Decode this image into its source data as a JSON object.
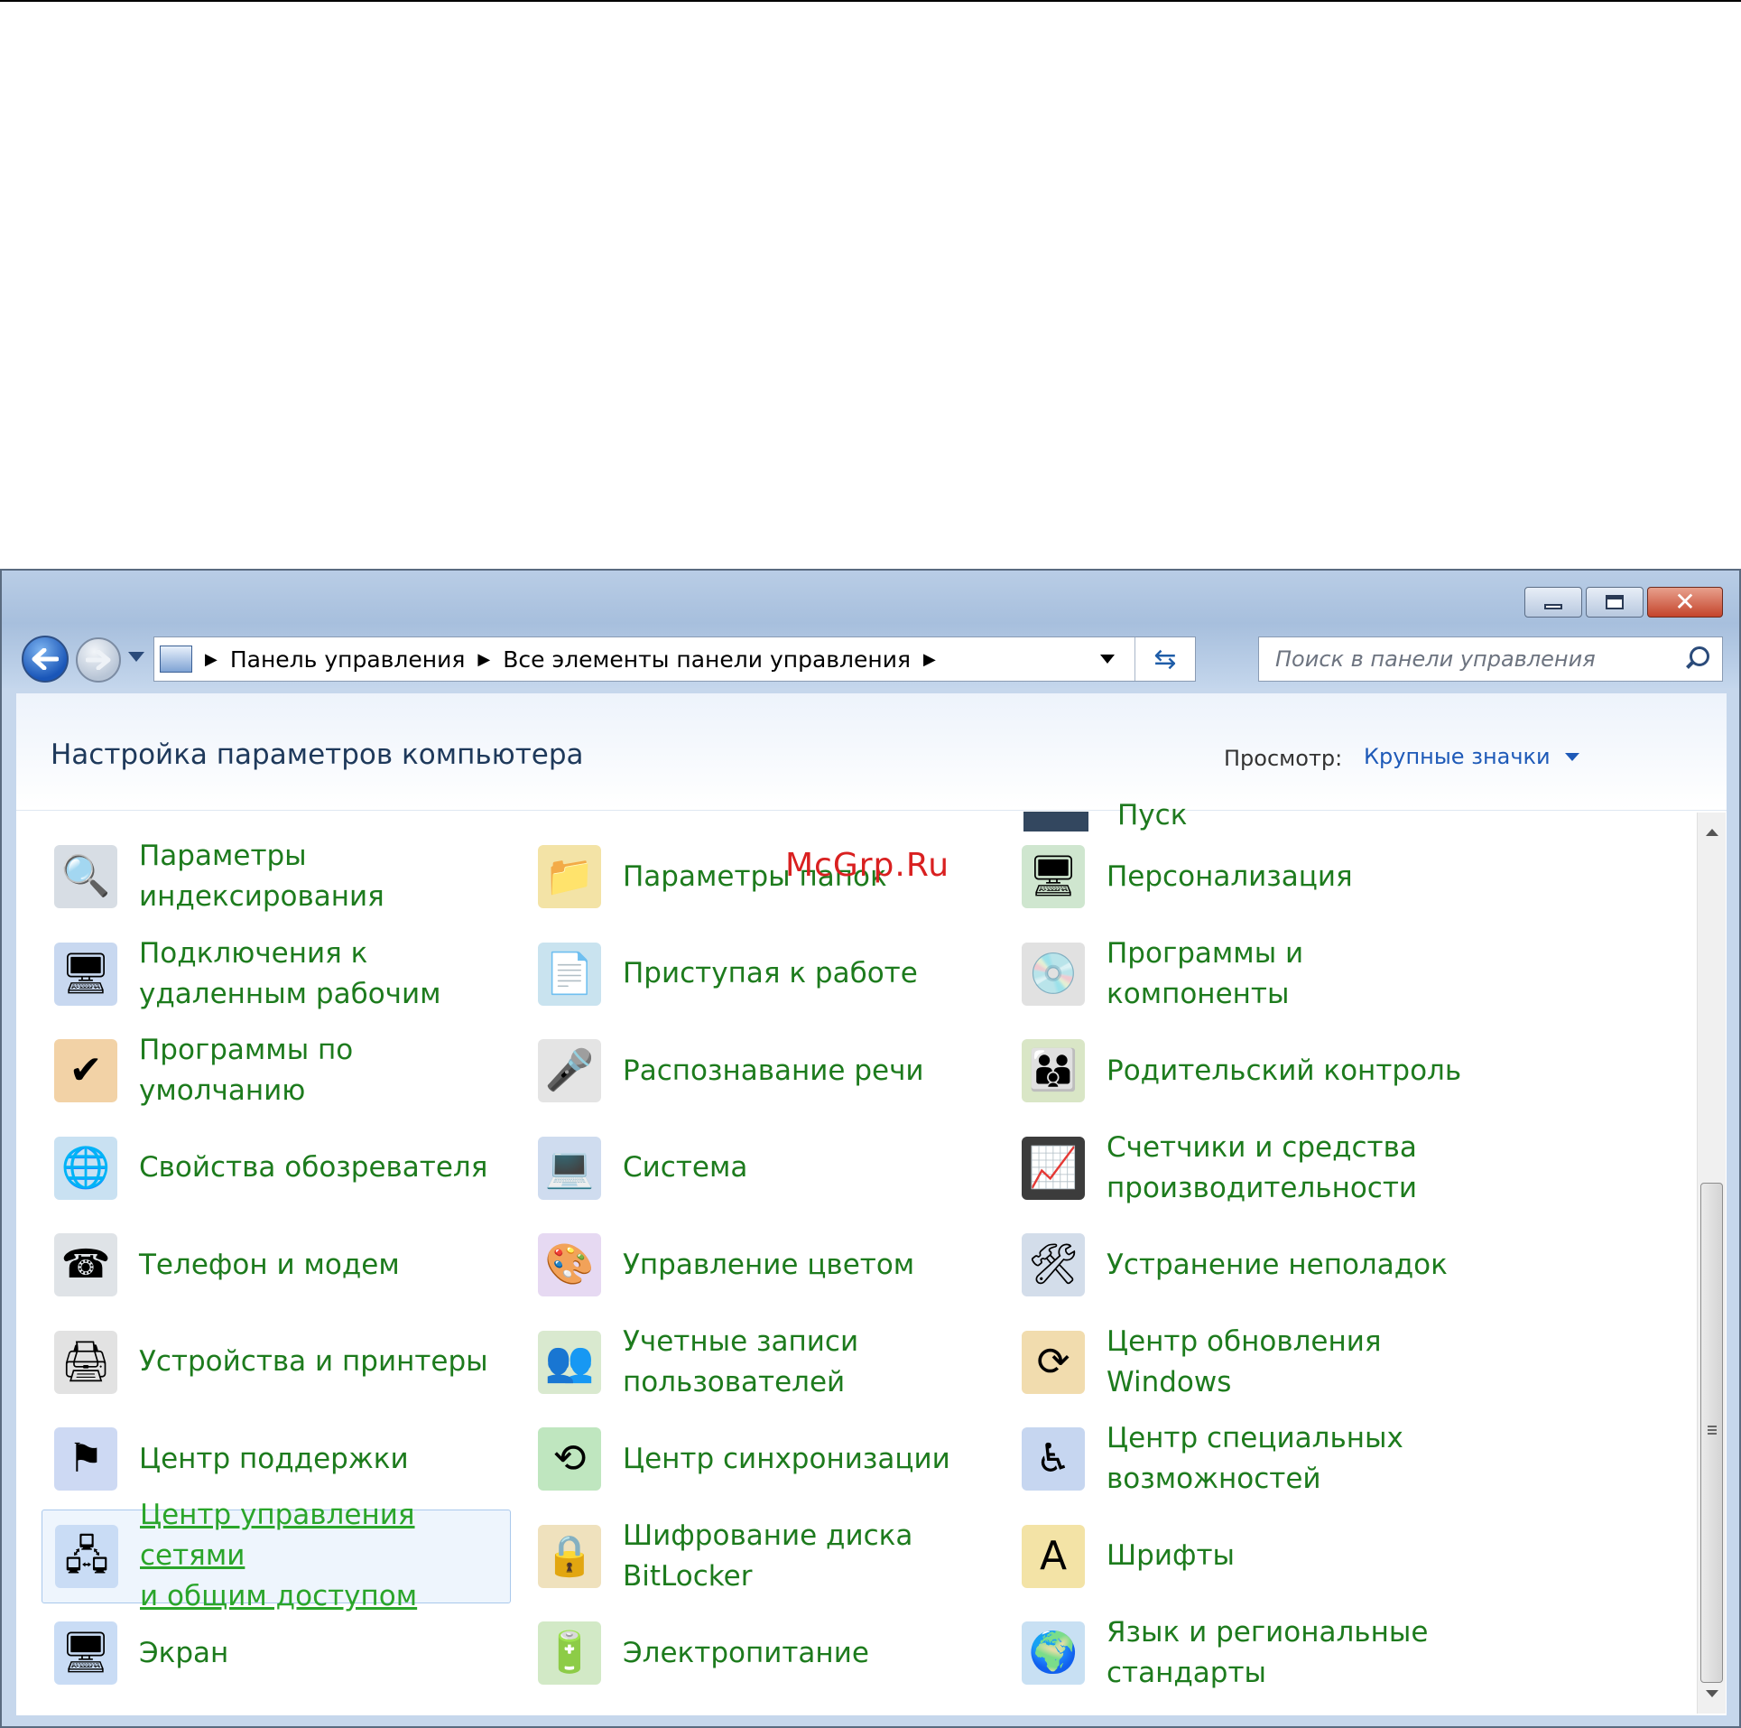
{
  "watermark": "McGrp.Ru",
  "address": {
    "crumbs": [
      "Панель управления",
      "Все элементы панели управления"
    ]
  },
  "search": {
    "placeholder": "Поиск в панели управления"
  },
  "header": {
    "title": "Настройка параметров компьютера",
    "view_label": "Просмотр:",
    "view_value": "Крупные значки"
  },
  "partial_top": {
    "col3_label": "Пуск"
  },
  "items": [
    {
      "label": "Параметры\nиндексирования",
      "icon": "magnifier-drive-icon",
      "glyph": "🔍",
      "color": "#d7dde4"
    },
    {
      "label": "Параметры папок",
      "icon": "folder-options-icon",
      "glyph": "📁",
      "color": "#f3e3a6"
    },
    {
      "label": "Персонализация",
      "icon": "monitor-personalize-icon",
      "glyph": "🖥",
      "color": "#cfe6cf"
    },
    {
      "label": "Подключения к\nудаленным рабочим",
      "icon": "remote-desktop-icon",
      "glyph": "🖥",
      "color": "#c8d8f0"
    },
    {
      "label": "Приступая к работе",
      "icon": "getting-started-icon",
      "glyph": "📄",
      "color": "#c9e3ef"
    },
    {
      "label": "Программы и\nкомпоненты",
      "icon": "programs-features-icon",
      "glyph": "💿",
      "color": "#e1e1e1"
    },
    {
      "label": "Программы по\nумолчанию",
      "icon": "default-programs-icon",
      "glyph": "✔",
      "color": "#f2d2a6"
    },
    {
      "label": "Распознавание речи",
      "icon": "microphone-icon",
      "glyph": "🎤",
      "color": "#e4e4e4"
    },
    {
      "label": "Родительский контроль",
      "icon": "parental-control-icon",
      "glyph": "👪",
      "color": "#d9e6c6"
    },
    {
      "label": "Свойства обозревателя",
      "icon": "internet-options-icon",
      "glyph": "🌐",
      "color": "#c9e1f2"
    },
    {
      "label": "Система",
      "icon": "system-icon",
      "glyph": "💻",
      "color": "#cfdcef"
    },
    {
      "label": "Счетчики и средства\nпроизводительности",
      "icon": "performance-icon",
      "glyph": "📈",
      "color": "#3c3c3c"
    },
    {
      "label": "Телефон и модем",
      "icon": "phone-modem-icon",
      "glyph": "☎",
      "color": "#dfe3e7"
    },
    {
      "label": "Управление цветом",
      "icon": "color-management-icon",
      "glyph": "🎨",
      "color": "#e6d9f2"
    },
    {
      "label": "Устранение неполадок",
      "icon": "troubleshooting-icon",
      "glyph": "🛠",
      "color": "#d3ddea"
    },
    {
      "label": "Устройства и принтеры",
      "icon": "devices-printers-icon",
      "glyph": "🖨",
      "color": "#e2e2e2"
    },
    {
      "label": "Учетные записи\nпользователей",
      "icon": "user-accounts-icon",
      "glyph": "👥",
      "color": "#d9e9cf"
    },
    {
      "label": "Центр обновления\nWindows",
      "icon": "windows-update-icon",
      "glyph": "⟳",
      "color": "#f1dcae"
    },
    {
      "label": "Центр поддержки",
      "icon": "action-center-flag-icon",
      "glyph": "⚑",
      "color": "#cdd9f3"
    },
    {
      "label": "Центр синхронизации",
      "icon": "sync-center-icon",
      "glyph": "⟲",
      "color": "#bfe6bf"
    },
    {
      "label": "Центр специальных\nвозможностей",
      "icon": "ease-of-access-icon",
      "glyph": "♿",
      "color": "#c6d6f0"
    },
    {
      "label": "Центр управления сетями\nи общим доступом",
      "icon": "network-sharing-icon",
      "glyph": "🖧",
      "color": "#c9dcf5"
    },
    {
      "label": "Шифрование диска\nBitLocker",
      "icon": "bitlocker-icon",
      "glyph": "🔒",
      "color": "#efe1bd"
    },
    {
      "label": "Шрифты",
      "icon": "fonts-folder-icon",
      "glyph": "A",
      "color": "#f3e3a6"
    },
    {
      "label": "Экран",
      "icon": "display-icon",
      "glyph": "🖥",
      "color": "#c9dcf5"
    },
    {
      "label": "Электропитание",
      "icon": "power-options-icon",
      "glyph": "🔋",
      "color": "#d2e9c6"
    },
    {
      "label": "Язык и региональные\nстандарты",
      "icon": "region-language-icon",
      "glyph": "🌍",
      "color": "#c8e0f3"
    }
  ]
}
